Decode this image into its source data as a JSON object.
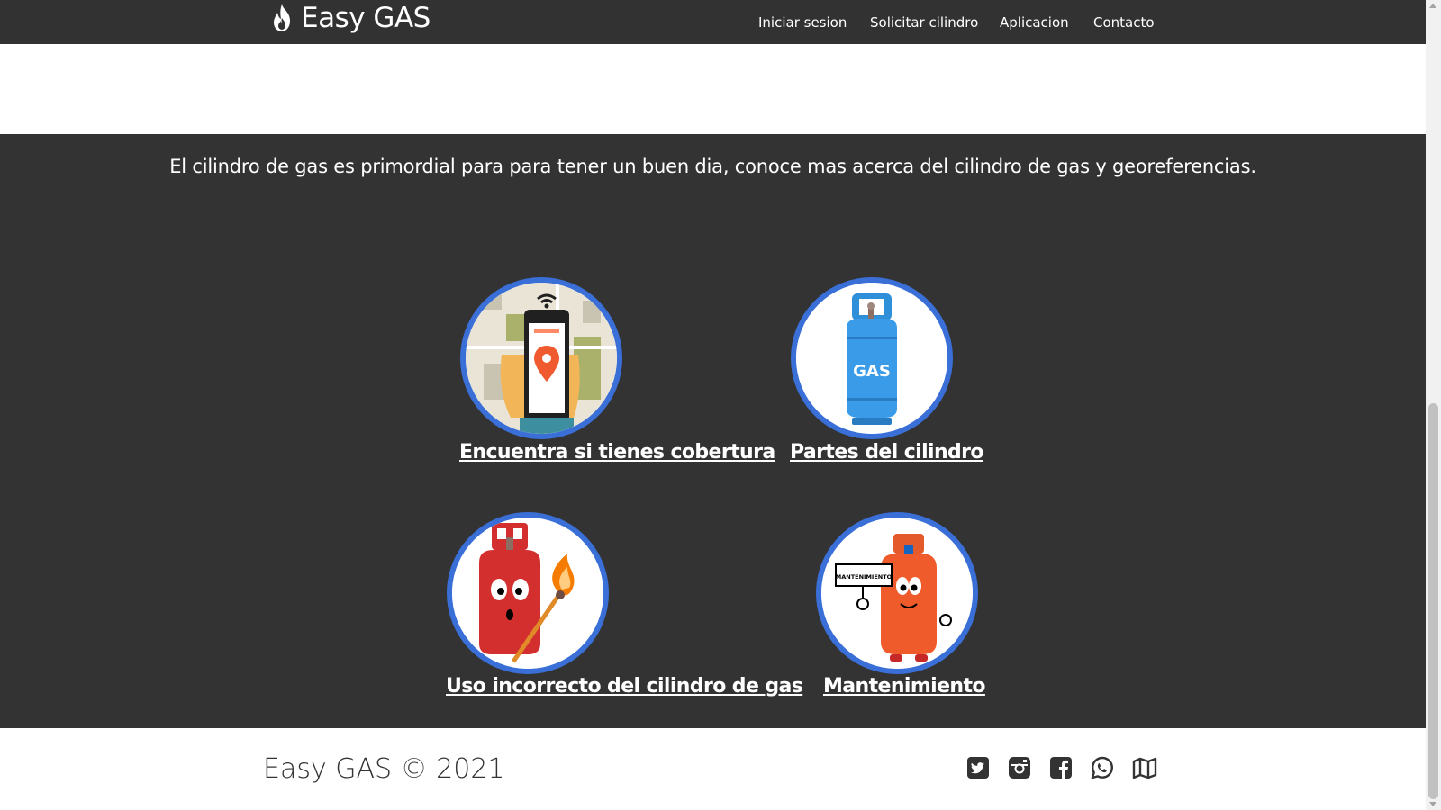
{
  "navbar": {
    "brand": "Easy GAS",
    "links": [
      "Iniciar sesion",
      "Solicitar cilindro",
      "Aplicacion",
      "Contacto"
    ]
  },
  "intro_text": "El cilindro de gas es primordial para para tener un buen dia, conoce mas acerca del cilindro de gas y georeferencias.",
  "cards": [
    {
      "label": "Encuentra si tienes cobertura",
      "image": "phone-map-pin-image"
    },
    {
      "label": "Partes del cilindro",
      "image": "blue-gas-cylinder-image",
      "image_text": "GAS"
    },
    {
      "label": "Uso incorrecto del cilindro de gas",
      "image": "red-cylinder-match-image"
    },
    {
      "label": "Mantenimiento",
      "image": "orange-cylinder-sign-image",
      "image_text": "MANTENIMIENTO"
    }
  ],
  "footer": {
    "copyright": "Easy GAS © 2021",
    "social_icons": [
      "twitter-icon",
      "instagram-icon",
      "facebook-icon",
      "whatsapp-icon",
      "map-icon"
    ]
  },
  "colors": {
    "navbar_bg": "#323232",
    "section_bg": "#333333",
    "circle_border": "#3a6fd8",
    "text_light": "#ffffff",
    "footer_text": "#333333"
  }
}
